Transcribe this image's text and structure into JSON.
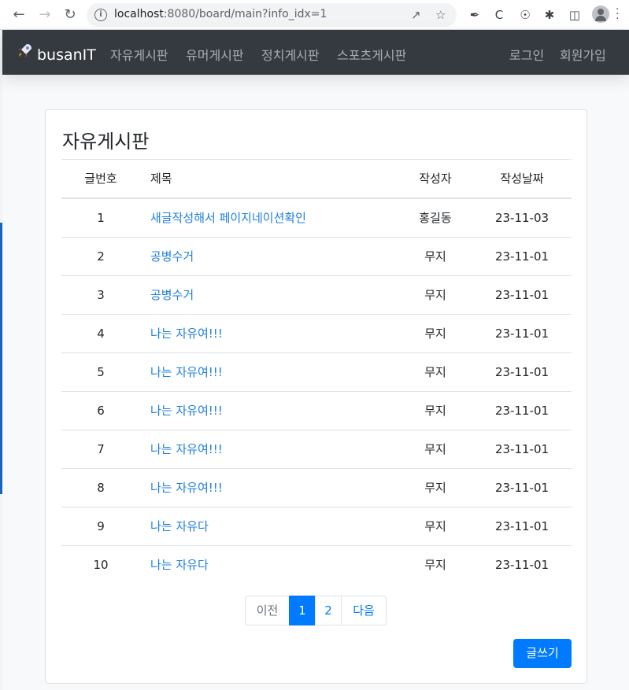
{
  "browser": {
    "url_host": "localhost",
    "url_rest": ":8080/board/main?info_idx=1"
  },
  "navbar": {
    "brand": "busanIT",
    "links": [
      "자유게시판",
      "유머게시판",
      "정치게시판",
      "스포츠게시판"
    ],
    "login": "로그인",
    "signup": "회원가입"
  },
  "board": {
    "title": "자유게시판",
    "columns": {
      "num": "글번호",
      "title": "제목",
      "writer": "작성자",
      "date": "작성날짜"
    },
    "rows": [
      {
        "num": "1",
        "title": "새글작성해서 페이지네이션확인",
        "writer": "홍길동",
        "date": "23-11-03"
      },
      {
        "num": "2",
        "title": "공병수거",
        "writer": "무지",
        "date": "23-11-01"
      },
      {
        "num": "3",
        "title": "공병수거",
        "writer": "무지",
        "date": "23-11-01"
      },
      {
        "num": "4",
        "title": "나는 자유여!!!",
        "writer": "무지",
        "date": "23-11-01"
      },
      {
        "num": "5",
        "title": "나는 자유여!!!",
        "writer": "무지",
        "date": "23-11-01"
      },
      {
        "num": "6",
        "title": "나는 자유여!!!",
        "writer": "무지",
        "date": "23-11-01"
      },
      {
        "num": "7",
        "title": "나는 자유여!!!",
        "writer": "무지",
        "date": "23-11-01"
      },
      {
        "num": "8",
        "title": "나는 자유여!!!",
        "writer": "무지",
        "date": "23-11-01"
      },
      {
        "num": "9",
        "title": "나는 자유다",
        "writer": "무지",
        "date": "23-11-01"
      },
      {
        "num": "10",
        "title": "나는 자유다",
        "writer": "무지",
        "date": "23-11-01"
      }
    ]
  },
  "pagination": {
    "prev": "이전",
    "pages": [
      "1",
      "2"
    ],
    "active": "1",
    "next": "다음"
  },
  "write_button": "글쓰기",
  "colors": {
    "navbar": "#343a40",
    "primary": "#007bff",
    "link": "#1f7fe0"
  }
}
